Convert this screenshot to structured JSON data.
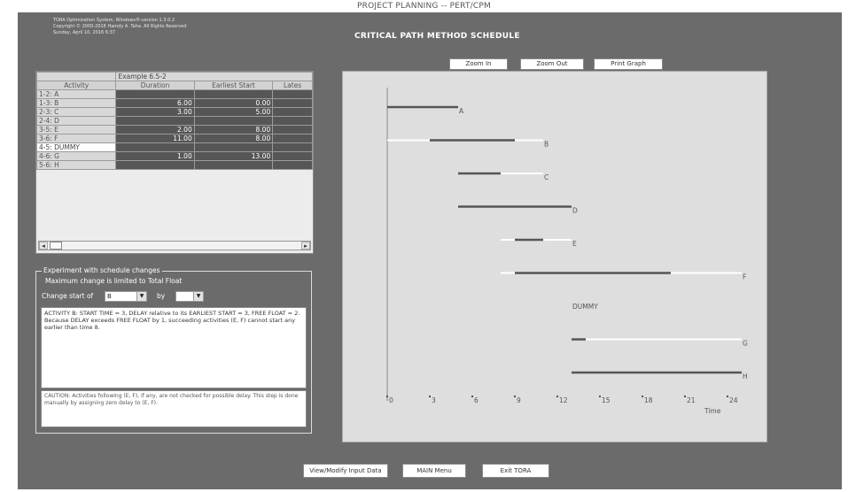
{
  "page_title": "PROJECT PLANNING -- PERT/CPM",
  "copyright": [
    "TORA Optimization System, Windows®-version 1.3.0.2",
    "Copyright © 2000-2016 Hamdy A. Taha. All Rights Reserved",
    "Sunday, April 10, 2016 6:37"
  ],
  "main_title": "CRITICAL PATH METHOD SCHEDULE",
  "grid": {
    "example_label": "Example 6.5-2",
    "headers": [
      "Activity",
      "Duration",
      "Earliest Start",
      "Lates"
    ],
    "rows": [
      {
        "activity": "1-2: A",
        "duration": "",
        "earliest": ""
      },
      {
        "activity": "1-3: B",
        "duration": "6.00",
        "earliest": "0.00"
      },
      {
        "activity": "2-3: C",
        "duration": "3.00",
        "earliest": "5.00"
      },
      {
        "activity": "2-4: D",
        "duration": "",
        "earliest": ""
      },
      {
        "activity": "3-5: E",
        "duration": "2.00",
        "earliest": "8.00"
      },
      {
        "activity": "3-6: F",
        "duration": "11.00",
        "earliest": "8.00"
      },
      {
        "activity": "4-5: DUMMY",
        "duration": "",
        "earliest": ""
      },
      {
        "activity": "4-6: G",
        "duration": "1.00",
        "earliest": "13.00"
      },
      {
        "activity": "5-6: H",
        "duration": "",
        "earliest": ""
      }
    ]
  },
  "experiment": {
    "legend": "Experiment with schedule changes",
    "max_change_text": "Maximum change is limited to Total Float",
    "change_start_label": "Change start of",
    "change_start_value": "B",
    "by_label": "by",
    "by_value": "",
    "message": "ACTIVITY B:  START TIME = 3, DELAY relative to its EARLIEST START = 3, FREE FLOAT = 2.  Because DELAY exceeds FREE FLOAT by 1, succeeding activities (E, F) cannot start any earlier than time  8.",
    "caution": "CAUTION: Activities following (E, F), if any, are not checked for possible delay. This step is done manually by assigning zero delay to (E, F)."
  },
  "graph_buttons": {
    "zoom_in": "Zoom In",
    "zoom_out": "Zoom Out",
    "print_graph": "Print Graph"
  },
  "chart_data": {
    "type": "bar",
    "title": "",
    "xlabel": "Time",
    "ylabel": "",
    "xlim": [
      0,
      24
    ],
    "x_ticks": [
      "0",
      "3",
      "6",
      "9",
      "12",
      "15",
      "18",
      "21",
      "24"
    ],
    "activities": [
      {
        "name": "A",
        "white_start": 0,
        "white_end": 5,
        "dark_start": 0,
        "dark_end": 5
      },
      {
        "name": "B",
        "white_start": 0,
        "white_end": 11,
        "dark_start": 3,
        "dark_end": 9
      },
      {
        "name": "C",
        "white_start": 5,
        "white_end": 11,
        "dark_start": 5,
        "dark_end": 8
      },
      {
        "name": "D",
        "white_start": 5,
        "white_end": 13,
        "dark_start": 5,
        "dark_end": 13
      },
      {
        "name": "E",
        "white_start": 8,
        "white_end": 13,
        "dark_start": 9,
        "dark_end": 11
      },
      {
        "name": "F",
        "white_start": 8,
        "white_end": 25,
        "dark_start": 9,
        "dark_end": 20
      },
      {
        "name": "DUMMY",
        "white_start": 13,
        "white_end": 13,
        "dark_start": 13,
        "dark_end": 13
      },
      {
        "name": "G",
        "white_start": 13,
        "white_end": 25,
        "dark_start": 13,
        "dark_end": 14
      },
      {
        "name": "H",
        "white_start": 13,
        "white_end": 25,
        "dark_start": 13,
        "dark_end": 25
      }
    ],
    "colors": {
      "dark_bar": "#555555",
      "float_bar": "#ffffff",
      "background": "#dedede"
    }
  },
  "bottom_buttons": {
    "modify": "View/Modify Input Data",
    "main_menu": "MAIN Menu",
    "exit": "Exit TORA"
  }
}
